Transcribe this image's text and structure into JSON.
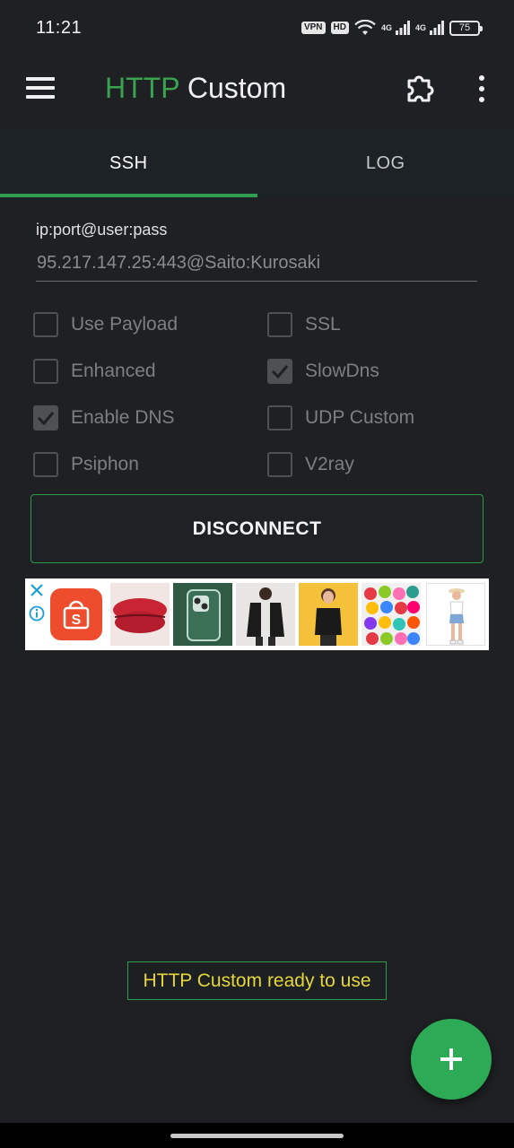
{
  "status_bar": {
    "time": "11:21",
    "vpn_badge": "VPN",
    "hd_badge": "HD",
    "net1": "4G",
    "net2": "4G",
    "battery": "75"
  },
  "app_bar": {
    "title_part1": "HTTP",
    "title_part2": " Custom",
    "title_color": "#3aa34f",
    "menu_icon": "hamburger-menu-icon",
    "plugin_icon": "puzzle-piece-icon",
    "more_icon": "more-vert-icon"
  },
  "tabs": [
    {
      "label": "SSH",
      "active": true
    },
    {
      "label": "LOG",
      "active": false
    }
  ],
  "connection": {
    "label": "ip:port@user:pass",
    "value": "95.217.147.25:443@Saito:Kurosaki"
  },
  "options": {
    "use_payload": {
      "label": "Use Payload",
      "checked": false
    },
    "ssl": {
      "label": "SSL",
      "checked": false
    },
    "enhanced": {
      "label": "Enhanced",
      "checked": false
    },
    "slowdns": {
      "label": "SlowDns",
      "checked": true
    },
    "enable_dns": {
      "label": "Enable DNS",
      "checked": true
    },
    "udp_custom": {
      "label": "UDP Custom",
      "checked": false
    },
    "psiphon": {
      "label": "Psiphon",
      "checked": false
    },
    "v2ray": {
      "label": "V2ray",
      "checked": false
    }
  },
  "disconnect_label": "DISCONNECT",
  "ad": {
    "brand_letter": "S",
    "brand_color": "#ee4d2d",
    "thumbnails": [
      "lipstick",
      "phone-case",
      "black-jacket",
      "woman-black-top",
      "colorful-balls",
      "woman-denim-shorts"
    ]
  },
  "status_message": "HTTP Custom ready to use",
  "status_color": "#e6d63a",
  "fab_icon": "plus-icon",
  "accent_color": "#2f9e4f"
}
